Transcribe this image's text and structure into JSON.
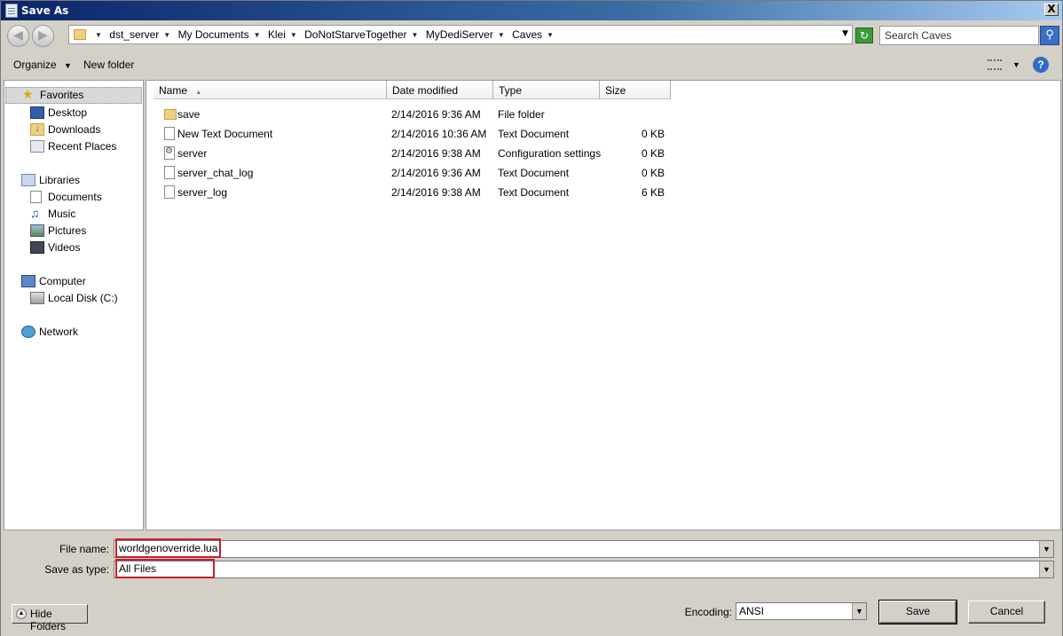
{
  "window": {
    "title": "Save As",
    "close_label": "X"
  },
  "address": {
    "crumbs": [
      "dst_server",
      "My Documents",
      "Klei",
      "DoNotStarveTogether",
      "MyDediServer",
      "Caves"
    ],
    "search_placeholder": "Search Caves"
  },
  "toolbar": {
    "organize_label": "Organize",
    "new_folder_label": "New folder"
  },
  "nav": {
    "favorites": "Favorites",
    "desktop": "Desktop",
    "downloads": "Downloads",
    "recent": "Recent Places",
    "libraries": "Libraries",
    "documents": "Documents",
    "music": "Music",
    "pictures": "Pictures",
    "videos": "Videos",
    "computer": "Computer",
    "localdisk": "Local Disk (C:)",
    "network": "Network"
  },
  "columns": {
    "name": "Name",
    "date": "Date modified",
    "type": "Type",
    "size": "Size"
  },
  "files": [
    {
      "name": "save",
      "date": "2/14/2016 9:36 AM",
      "type": "File folder",
      "size": "",
      "icon": "folder-icon"
    },
    {
      "name": "New Text Document",
      "date": "2/14/2016 10:36 AM",
      "type": "Text Document",
      "size": "0 KB",
      "icon": "text-file-icon"
    },
    {
      "name": "server",
      "date": "2/14/2016 9:38 AM",
      "type": "Configuration settings",
      "size": "0 KB",
      "icon": "config-file-icon"
    },
    {
      "name": "server_chat_log",
      "date": "2/14/2016 9:36 AM",
      "type": "Text Document",
      "size": "0 KB",
      "icon": "text-file-icon"
    },
    {
      "name": "server_log",
      "date": "2/14/2016 9:38 AM",
      "type": "Text Document",
      "size": "6 KB",
      "icon": "text-file-icon"
    }
  ],
  "form": {
    "filename_label": "File name:",
    "filename_value": "worldgenoverride.lua",
    "savetype_label": "Save as type:",
    "savetype_value": "All Files",
    "encoding_label": "Encoding:",
    "encoding_value": "ANSI",
    "save_label": "Save",
    "cancel_label": "Cancel",
    "hide_folders_label": "Hide Folders"
  },
  "colors": {
    "highlight_border": "#c8202a",
    "title_bar": "#0a246a"
  }
}
